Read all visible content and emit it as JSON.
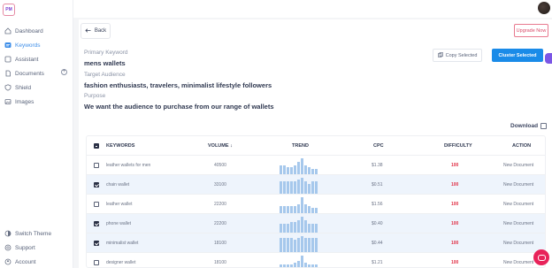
{
  "sidebar": {
    "logo_text": "PM",
    "items": [
      {
        "label": "Dashboard",
        "icon": "home-icon"
      },
      {
        "label": "Keywords",
        "icon": "keywords-icon"
      },
      {
        "label": "Assistant",
        "icon": "assistant-icon"
      },
      {
        "label": "Documents",
        "icon": "document-icon"
      },
      {
        "label": "Shield",
        "icon": "shield-icon"
      },
      {
        "label": "Images",
        "icon": "image-icon"
      }
    ],
    "bottom_items": [
      {
        "label": "Switch Theme",
        "icon": "theme-icon"
      },
      {
        "label": "Support",
        "icon": "support-icon"
      },
      {
        "label": "Account",
        "icon": "account-icon"
      }
    ]
  },
  "header": {
    "back_label": "Back",
    "upgrade_label": "Upgrade Now"
  },
  "details": {
    "primary_keyword_label": "Primary Keyword",
    "primary_keyword": "mens wallets",
    "target_audience_label": "Target Audience",
    "target_audience": "fashion enthusiasts, travelers, minimalist lifestyle followers",
    "purpose_label": "Purpose",
    "purpose": "We want the audience to purchase from our range of wallets"
  },
  "actions": {
    "copy_label": "Copy Selected",
    "cluster_label": "Cluster Selected",
    "download_label": "Download"
  },
  "table": {
    "columns": {
      "keywords": "KEYWORDS",
      "volume": "VOLUME",
      "trend": "TREND",
      "cpc": "CPC",
      "difficulty": "DIFFICULTY",
      "action": "ACTION"
    },
    "rows": [
      {
        "keyword": "leather wallets for men",
        "volume": "40500",
        "cpc": "$1.38",
        "difficulty": "100",
        "action": "New Document",
        "selected": false,
        "trend": [
          5,
          5,
          4,
          4,
          5,
          7,
          9,
          5,
          4,
          3,
          3
        ]
      },
      {
        "keyword": "chain wallet",
        "volume": "33100",
        "cpc": "$0.51",
        "difficulty": "100",
        "action": "New Document",
        "selected": true,
        "trend": [
          6,
          6,
          6,
          6,
          6,
          7,
          8,
          6,
          5,
          6,
          6
        ]
      },
      {
        "keyword": "leather wallet",
        "volume": "22200",
        "cpc": "$1.56",
        "difficulty": "100",
        "action": "New Document",
        "selected": false,
        "trend": [
          4,
          4,
          4,
          4,
          4,
          5,
          9,
          5,
          4,
          3,
          3
        ]
      },
      {
        "keyword": "phone wallet",
        "volume": "22200",
        "cpc": "$0.40",
        "difficulty": "100",
        "action": "New Document",
        "selected": true,
        "trend": [
          5,
          5,
          5,
          6,
          6,
          7,
          9,
          7,
          5,
          5,
          5
        ]
      },
      {
        "keyword": "minimalist wallet",
        "volume": "18100",
        "cpc": "$0.44",
        "difficulty": "100",
        "action": "New Document",
        "selected": true,
        "trend": [
          8,
          8,
          8,
          8,
          7,
          8,
          9,
          8,
          8,
          8,
          8
        ]
      },
      {
        "keyword": "designer wallet",
        "volume": "18100",
        "cpc": "$1.21",
        "difficulty": "100",
        "action": "New Document",
        "selected": false,
        "trend": [
          4,
          4,
          4,
          4,
          5,
          6,
          9,
          5,
          4,
          4,
          4
        ]
      }
    ]
  }
}
